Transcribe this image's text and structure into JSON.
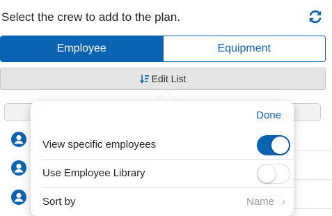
{
  "header": {
    "title": "Select the crew to add to the plan."
  },
  "segments": [
    {
      "label": "Employee",
      "active": true
    },
    {
      "label": "Equipment",
      "active": false
    }
  ],
  "toolbar": {
    "edit_label": "Edit List"
  },
  "popover": {
    "done_label": "Done",
    "rows": [
      {
        "label": "View specific employees",
        "toggle": true
      },
      {
        "label": "Use Employee Library",
        "toggle": false
      },
      {
        "label": "Sort by",
        "value": "Name"
      }
    ]
  },
  "colors": {
    "accent": "#0a63b3"
  }
}
